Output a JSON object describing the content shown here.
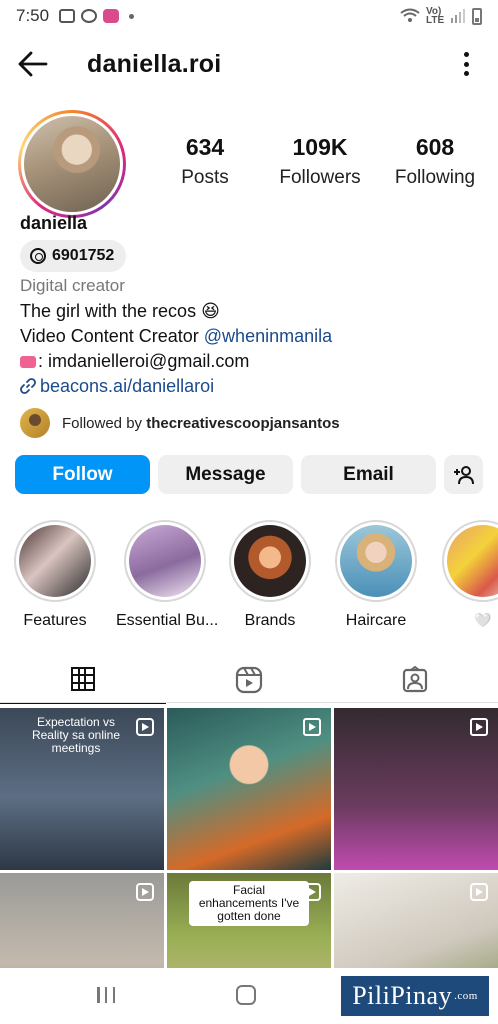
{
  "status_bar": {
    "time": "7:50",
    "network_label": "Vo) LTE"
  },
  "header": {
    "username": "daniella.roi"
  },
  "profile": {
    "display_name": "daniella",
    "threads_handle": "6901752",
    "stats": [
      {
        "value": "634",
        "label": "Posts"
      },
      {
        "value": "109K",
        "label": "Followers"
      },
      {
        "value": "608",
        "label": "Following"
      }
    ],
    "category": "Digital creator",
    "bio": {
      "line1": "The girl with the recos 😆",
      "line2_prefix": "Video Content Creator ",
      "line2_mention": "@wheninmanila",
      "line3": ": imdanielleroi@gmail.com",
      "link": "beacons.ai/daniellaroi"
    },
    "followed_by_prefix": "Followed by ",
    "followed_by_name": "thecreativescoopjansantos"
  },
  "buttons": {
    "follow": "Follow",
    "message": "Message",
    "email": "Email"
  },
  "highlights": [
    {
      "label": "Features"
    },
    {
      "label": "Essential Bu..."
    },
    {
      "label": "Brands"
    },
    {
      "label": "Haircare"
    },
    {
      "label": "🤍"
    }
  ],
  "posts": {
    "post1_caption": "Expectation vs Reality sa online meetings",
    "post5_caption": "Facial enhancements I've gotten done"
  },
  "watermark": {
    "main": "PiliPinay",
    "suffix": ".com"
  },
  "colors": {
    "follow_button": "#0095f6",
    "link": "#1a4b8c",
    "secondary_button": "#efefef"
  }
}
